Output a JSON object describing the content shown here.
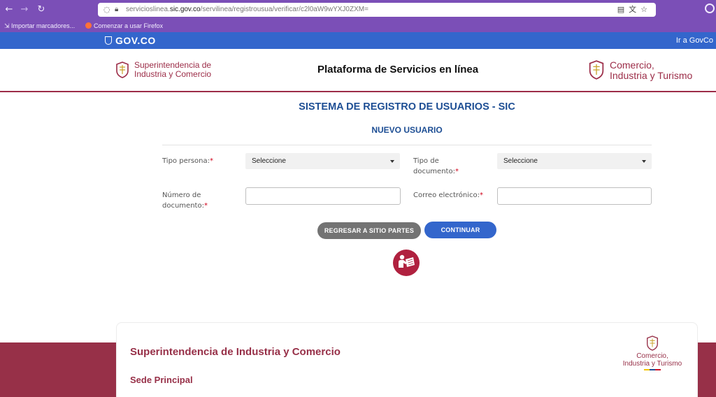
{
  "browser": {
    "url_prefix": "servicioslinea.",
    "url_domain": "sic.gov.co",
    "url_path": "/servilinea/registrousua/verificar/c2l0aW9wYXJ0ZXM=",
    "bookmarks": [
      "Importar marcadores...",
      "Comenzar a usar Firefox"
    ]
  },
  "govbar": {
    "logo": "GOV.CO",
    "link": "Ir a GovCo"
  },
  "header": {
    "sic_logo_line1": "Superintendencia de",
    "sic_logo_line2": "Industria y Comercio",
    "title": "Plataforma de Servicios en línea",
    "mincit_line1": "Comercio,",
    "mincit_line2": "Industria y Turismo"
  },
  "form": {
    "system_title": "SISTEMA DE REGISTRO DE USUARIOS - SIC",
    "subtitle": "NUEVO USUARIO",
    "required_mark": "*",
    "tipo_persona_label": "Tipo persona:",
    "tipo_persona_value": "Seleccione",
    "tipo_documento_label_1": "Tipo de",
    "tipo_documento_label_2": "documento:",
    "tipo_documento_value": "Seleccione",
    "numero_documento_label_1": "Número de",
    "numero_documento_label_2": "documento:",
    "numero_documento_value": "",
    "correo_label": "Correo electrónico:",
    "correo_value": "",
    "back_button": "REGRESAR A SITIO PARTES",
    "continue_button": "CONTINUAR"
  },
  "footer": {
    "title": "Superintendencia de Industria y Comercio",
    "sede": "Sede Principal",
    "logo_line1": "Comercio,",
    "logo_line2": "Industria y Turismo"
  },
  "colors": {
    "purple_chrome": "#7b4fb7",
    "gov_blue": "#3366cc",
    "sic_maroon": "#9c2d48",
    "title_blue": "#1d4e94",
    "footer_band": "#973048"
  }
}
